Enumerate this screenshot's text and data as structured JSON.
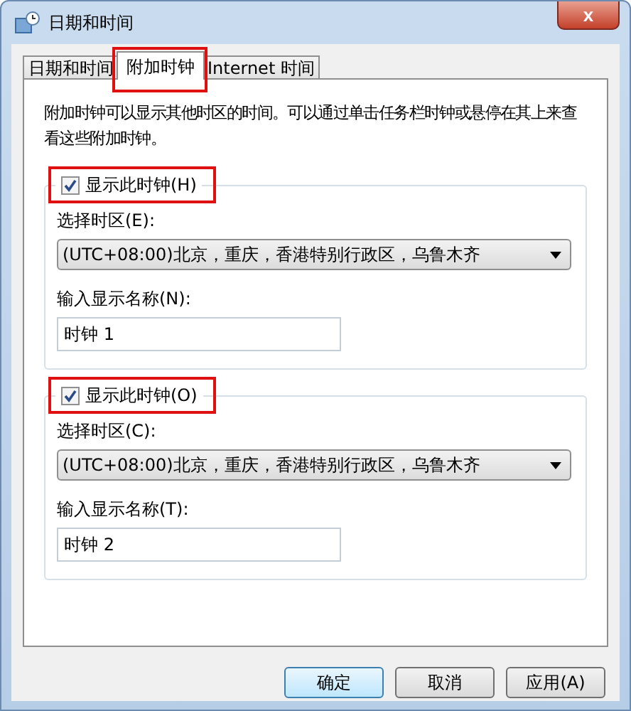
{
  "window": {
    "title": "日期和时间",
    "close": "x"
  },
  "tabs": [
    {
      "label": "日期和时间",
      "selected": false,
      "highlighted": false
    },
    {
      "label": "附加时钟",
      "selected": true,
      "highlighted": true
    },
    {
      "label": "Internet 时间",
      "selected": false,
      "highlighted": false
    }
  ],
  "description": "附加时钟可以显示其他时区的时间。可以通过单击任务栏时钟或悬停在其上来查看这些附加时钟。",
  "clocks": [
    {
      "checkbox": "显示此时钟(H)",
      "checked": true,
      "highlighted": true,
      "timezone_label": "选择时区(E):",
      "timezone": "(UTC+08:00)北京，重庆，香港特别行政区，乌鲁木齐",
      "name_label": "输入显示名称(N):",
      "name": "时钟 1"
    },
    {
      "checkbox": "显示此时钟(O)",
      "checked": true,
      "highlighted": true,
      "timezone_label": "选择时区(C):",
      "timezone": "(UTC+08:00)北京，重庆，香港特别行政区，乌鲁木齐",
      "name_label": "输入显示名称(T):",
      "name": "时钟 2"
    }
  ],
  "buttons": [
    {
      "label": "确定",
      "default": true
    },
    {
      "label": "取消",
      "default": false
    },
    {
      "label": "应用(A)",
      "default": false
    }
  ]
}
